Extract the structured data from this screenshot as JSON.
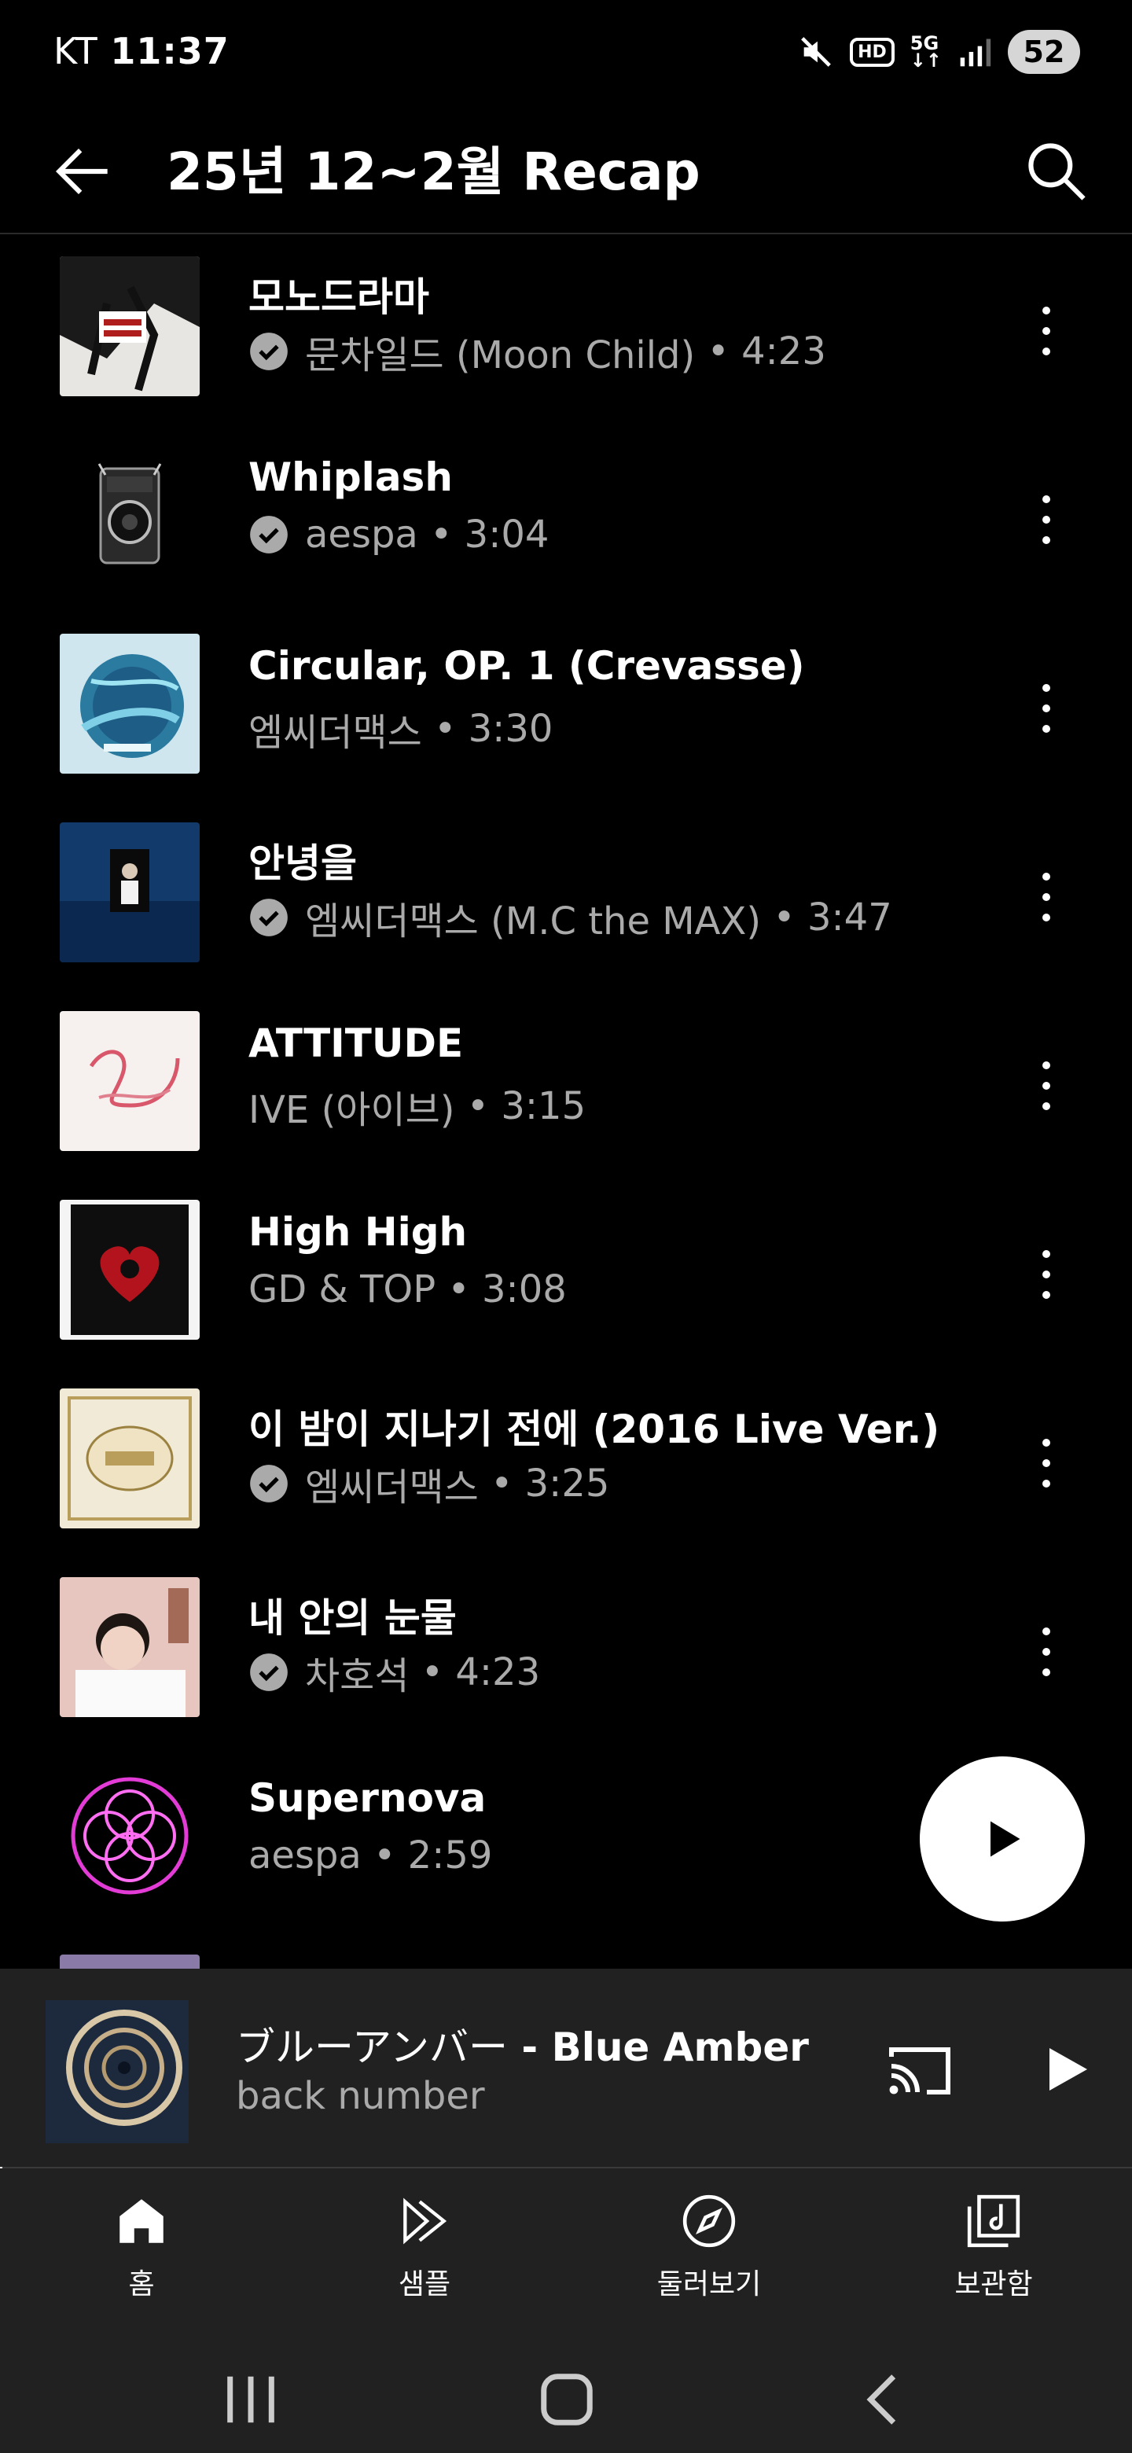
{
  "status_bar": {
    "carrier": "KT",
    "time": "11:37",
    "battery": "52",
    "icons": [
      "mute-icon",
      "hd-icon",
      "5g-icon",
      "signal-icon",
      "battery-icon"
    ]
  },
  "header": {
    "title": "25년 12~2월 Recap",
    "back_icon": "back-arrow-icon",
    "search_icon": "search-icon"
  },
  "songs": [
    {
      "title": "모노드라마",
      "artist": "문차일드 (Moon Child)",
      "duration": "4:23",
      "sep": " • ",
      "verified": true
    },
    {
      "title": "Whiplash",
      "artist": "aespa",
      "duration": "3:04",
      "sep": " • ",
      "verified": true
    },
    {
      "title": "Circular, OP. 1 (Crevasse)",
      "artist": "엠씨더맥스",
      "duration": "3:30",
      "sep": " • ",
      "verified": false
    },
    {
      "title": "안녕을",
      "artist": "엠씨더맥스 (M.C the MAX)",
      "duration": "3:47",
      "sep": " • ",
      "verified": true
    },
    {
      "title": "ATTITUDE",
      "artist": "IVE (아이브)",
      "duration": "3:15",
      "sep": " • ",
      "verified": false
    },
    {
      "title": "High High",
      "artist": "GD & TOP",
      "duration": "3:08",
      "sep": " • ",
      "verified": false
    },
    {
      "title": "이 밤이 지나기 전에 (2016 Live Ver.)",
      "artist": "엠씨더맥스",
      "duration": "3:25",
      "sep": " • ",
      "verified": true
    },
    {
      "title": "내 안의 눈물",
      "artist": "차호석",
      "duration": "4:23",
      "sep": " • ",
      "verified": true
    },
    {
      "title": "Supernova",
      "artist": "aespa",
      "duration": "2:59",
      "sep": " • ",
      "verified": false
    }
  ],
  "now_playing": {
    "title_ja": "ブルーアンバー",
    "title_sep": " - ",
    "title_en": "Blue Amber",
    "artist": "back number",
    "progress": 0.002
  },
  "bottom_nav": [
    {
      "label": "홈",
      "icon": "home-icon",
      "active": true
    },
    {
      "label": "샘플",
      "icon": "samples-icon",
      "active": false
    },
    {
      "label": "둘러보기",
      "icon": "explore-icon",
      "active": false
    },
    {
      "label": "보관함",
      "icon": "library-icon",
      "active": false
    }
  ],
  "system_nav": [
    "recent-apps-icon",
    "home-button-icon",
    "back-button-icon"
  ],
  "colors": {
    "background": "#000000",
    "surface": "#212121",
    "secondary_text": "#aaaaaa",
    "verified": "#aaaaaa"
  }
}
